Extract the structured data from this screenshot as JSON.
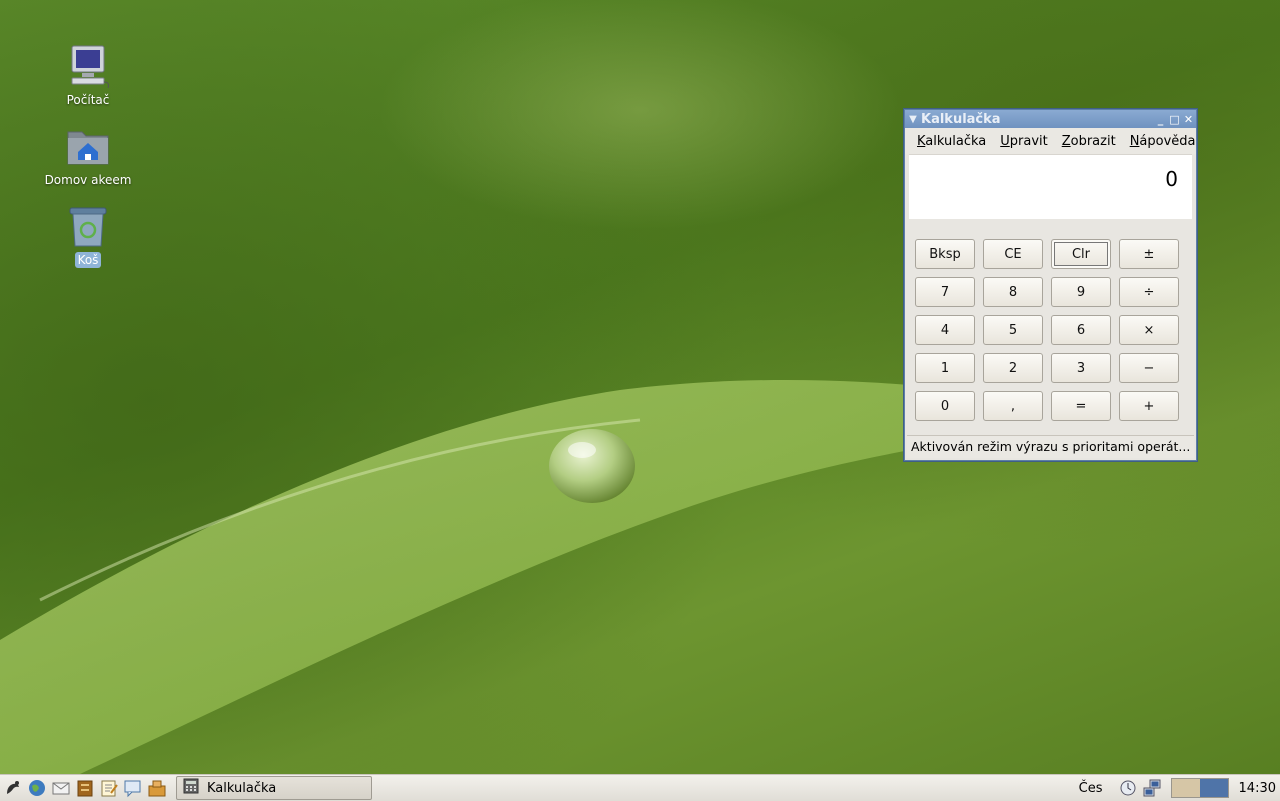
{
  "desktop": {
    "icons": [
      {
        "label": "Počítač",
        "icon": "computer-icon"
      },
      {
        "label": "Domov akeem",
        "icon": "home-folder-icon"
      },
      {
        "label": "Koš",
        "icon": "trash-icon"
      }
    ]
  },
  "calculator": {
    "title": "Kalkulačka",
    "menu": [
      {
        "label": "Kalkulačka",
        "mnemonic": "K"
      },
      {
        "label": "Upravit",
        "mnemonic": "U"
      },
      {
        "label": "Zobrazit",
        "mnemonic": "Z"
      },
      {
        "label": "Nápověda",
        "mnemonic": "N"
      }
    ],
    "display_value": "0",
    "keys": [
      [
        "Bksp",
        "CE",
        "Clr",
        "±"
      ],
      [
        "7",
        "8",
        "9",
        "÷"
      ],
      [
        "4",
        "5",
        "6",
        "×"
      ],
      [
        "1",
        "2",
        "3",
        "−"
      ],
      [
        "0",
        ",",
        "=",
        "+"
      ]
    ],
    "focused_key": "Clr",
    "status": "Aktivován režim výrazu s prioritami operát..."
  },
  "taskbar": {
    "task_label": "Kalkulačka",
    "keyboard_layout": "Čes",
    "clock": "14:30",
    "launchers": [
      "menu-icon",
      "browser-icon",
      "mail-icon",
      "file-manager-icon",
      "text-editor-icon",
      "chat-icon",
      "package-icon"
    ],
    "colors": {
      "workspace_1": "#d6c6a6",
      "workspace_2": "#4f74a8"
    }
  }
}
